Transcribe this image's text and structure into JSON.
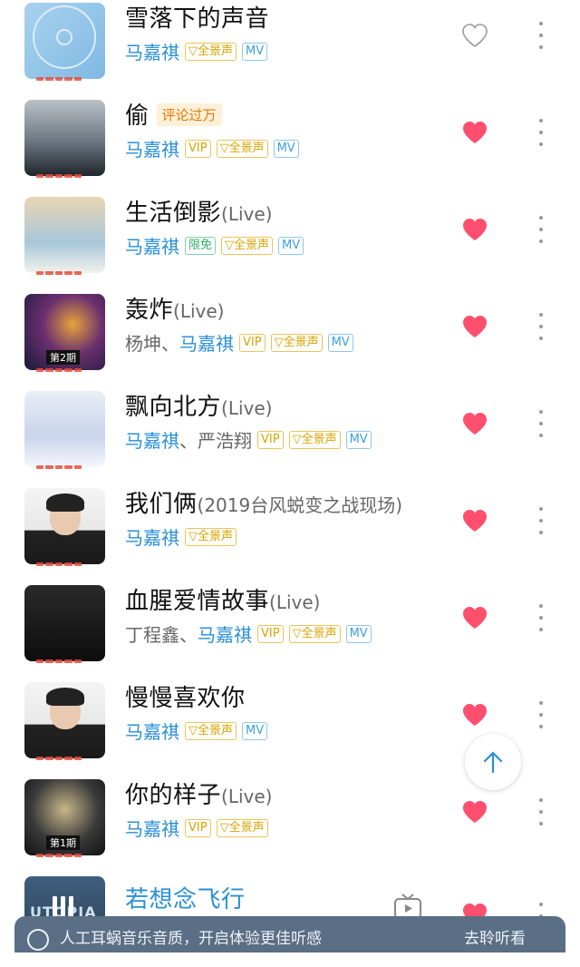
{
  "songs": [
    {
      "title": "雪落下的声音",
      "suffix": "",
      "hot_badge": "",
      "artists": [
        "马嘉祺"
      ],
      "artist_colors": [
        "blue"
      ],
      "tags": [
        {
          "type": "pan",
          "label": "▽全景声"
        },
        {
          "type": "mv",
          "label": "MV"
        }
      ],
      "liked": false,
      "cover": "disc"
    },
    {
      "title": "偷",
      "suffix": "",
      "hot_badge": "评论过万",
      "artists": [
        "马嘉祺"
      ],
      "artist_colors": [
        "blue"
      ],
      "tags": [
        {
          "type": "vip",
          "label": "VIP"
        },
        {
          "type": "pan",
          "label": "▽全景声"
        },
        {
          "type": "mv",
          "label": "MV"
        }
      ],
      "liked": true,
      "cover": "dark"
    },
    {
      "title": "生活倒影",
      "suffix": "(Live)",
      "hot_badge": "",
      "artists": [
        "马嘉祺"
      ],
      "artist_colors": [
        "blue"
      ],
      "tags": [
        {
          "type": "free",
          "label": "限免"
        },
        {
          "type": "pan",
          "label": "▽全景声"
        },
        {
          "type": "mv",
          "label": "MV"
        }
      ],
      "liked": true,
      "cover": "group"
    },
    {
      "title": "轰炸",
      "suffix": "(Live)",
      "hot_badge": "",
      "artists": [
        "杨坤",
        "马嘉祺"
      ],
      "artist_colors": [
        "grey",
        "blue"
      ],
      "tags": [
        {
          "type": "vip",
          "label": "VIP"
        },
        {
          "type": "pan",
          "label": "▽全景声"
        },
        {
          "type": "mv",
          "label": "MV"
        }
      ],
      "liked": true,
      "cover": "show",
      "cover_text": "第2期"
    },
    {
      "title": "飘向北方",
      "suffix": "(Live)",
      "hot_badge": "",
      "artists": [
        "马嘉祺",
        "严浩翔"
      ],
      "artist_colors": [
        "blue",
        "grey"
      ],
      "tags": [
        {
          "type": "vip",
          "label": "VIP"
        },
        {
          "type": "pan",
          "label": "▽全景声"
        },
        {
          "type": "mv",
          "label": "MV"
        }
      ],
      "liked": true,
      "cover": "light"
    },
    {
      "title": "我们俩",
      "suffix": "(2019台风蜕变之战现场)",
      "hot_badge": "",
      "artists": [
        "马嘉祺"
      ],
      "artist_colors": [
        "blue"
      ],
      "tags": [
        {
          "type": "pan",
          "label": "▽全景声"
        }
      ],
      "liked": true,
      "cover": "portrait"
    },
    {
      "title": "血腥爱情故事",
      "suffix": "(Live)",
      "hot_badge": "",
      "artists": [
        "丁程鑫",
        "马嘉祺"
      ],
      "artist_colors": [
        "grey",
        "blue"
      ],
      "tags": [
        {
          "type": "vip",
          "label": "VIP"
        },
        {
          "type": "pan",
          "label": "▽全景声"
        },
        {
          "type": "mv",
          "label": "MV"
        }
      ],
      "liked": true,
      "cover": "night"
    },
    {
      "title": "慢慢喜欢你",
      "suffix": "",
      "hot_badge": "",
      "artists": [
        "马嘉祺"
      ],
      "artist_colors": [
        "blue"
      ],
      "tags": [
        {
          "type": "pan",
          "label": "▽全景声"
        },
        {
          "type": "mv",
          "label": "MV"
        }
      ],
      "liked": true,
      "cover": "portrait"
    },
    {
      "title": "你的样子",
      "suffix": "(Live)",
      "hot_badge": "",
      "artists": [
        "马嘉祺"
      ],
      "artist_colors": [
        "blue"
      ],
      "tags": [
        {
          "type": "vip",
          "label": "VIP"
        },
        {
          "type": "pan",
          "label": "▽全景声"
        }
      ],
      "liked": true,
      "cover": "stage",
      "cover_text": "第1期"
    },
    {
      "title": "若想念飞行",
      "suffix": "",
      "hot_badge": "",
      "artists": [],
      "artist_colors": [],
      "tags": [],
      "liked": true,
      "cover": "utopia",
      "cover_text": "UTOPIA",
      "playing": true
    }
  ],
  "artist_separator": "、",
  "colors": {
    "accent": "#2a8fd8",
    "heart": "#ff4f6e",
    "vip": "#d9a400",
    "mv": "#3aa0e0",
    "free": "#2fae6a"
  },
  "icons": {
    "like": "heart-icon",
    "more": "more-vertical-icon",
    "back_to_top": "arrow-up-icon",
    "pause": "pause-icon",
    "mv_video": "tv-icon"
  },
  "player": {
    "text": "人工耳蜗音乐音质，开启体验更佳听感",
    "right_label": "去聆听看"
  }
}
